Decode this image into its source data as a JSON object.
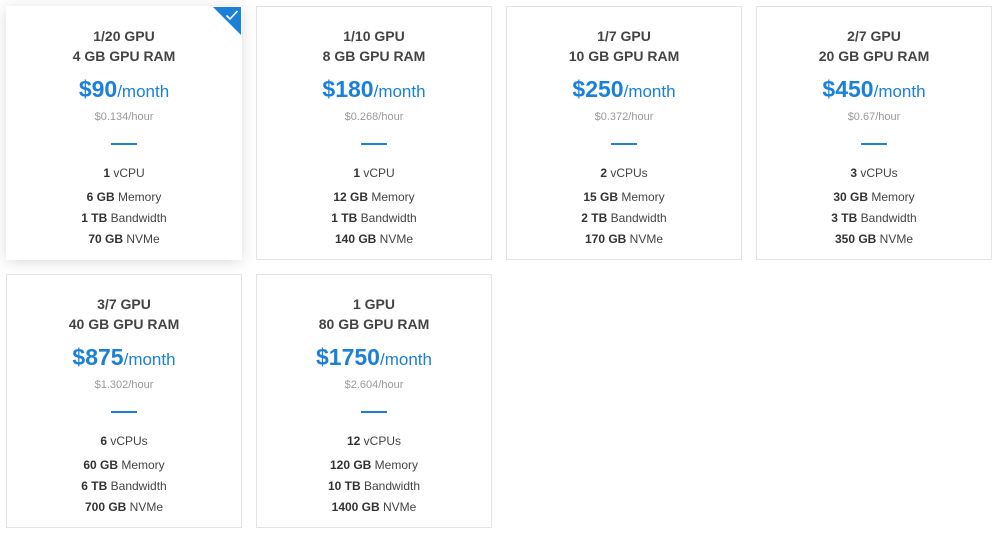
{
  "accent_color": "#1a80d8",
  "plans": [
    {
      "gpu": "1/20 GPU",
      "ram": "4 GB GPU RAM",
      "price": "$90",
      "price_unit": "/month",
      "hourly": "$0.134/hour",
      "specs": [
        {
          "value": "1",
          "label": "vCPU"
        },
        {
          "value": "6 GB",
          "label": "Memory"
        },
        {
          "value": "1 TB",
          "label": "Bandwidth"
        },
        {
          "value": "70 GB",
          "label": "NVMe"
        }
      ],
      "selected": true
    },
    {
      "gpu": "1/10 GPU",
      "ram": "8 GB GPU RAM",
      "price": "$180",
      "price_unit": "/month",
      "hourly": "$0.268/hour",
      "specs": [
        {
          "value": "1",
          "label": "vCPU"
        },
        {
          "value": "12 GB",
          "label": "Memory"
        },
        {
          "value": "1 TB",
          "label": "Bandwidth"
        },
        {
          "value": "140 GB",
          "label": "NVMe"
        }
      ],
      "selected": false
    },
    {
      "gpu": "1/7 GPU",
      "ram": "10 GB GPU RAM",
      "price": "$250",
      "price_unit": "/month",
      "hourly": "$0.372/hour",
      "specs": [
        {
          "value": "2",
          "label": "vCPUs"
        },
        {
          "value": "15 GB",
          "label": "Memory"
        },
        {
          "value": "2 TB",
          "label": "Bandwidth"
        },
        {
          "value": "170 GB",
          "label": "NVMe"
        }
      ],
      "selected": false
    },
    {
      "gpu": "2/7 GPU",
      "ram": "20 GB GPU RAM",
      "price": "$450",
      "price_unit": "/month",
      "hourly": "$0.67/hour",
      "specs": [
        {
          "value": "3",
          "label": "vCPUs"
        },
        {
          "value": "30 GB",
          "label": "Memory"
        },
        {
          "value": "3 TB",
          "label": "Bandwidth"
        },
        {
          "value": "350 GB",
          "label": "NVMe"
        }
      ],
      "selected": false
    },
    {
      "gpu": "3/7 GPU",
      "ram": "40 GB GPU RAM",
      "price": "$875",
      "price_unit": "/month",
      "hourly": "$1.302/hour",
      "specs": [
        {
          "value": "6",
          "label": "vCPUs"
        },
        {
          "value": "60 GB",
          "label": "Memory"
        },
        {
          "value": "6 TB",
          "label": "Bandwidth"
        },
        {
          "value": "700 GB",
          "label": "NVMe"
        }
      ],
      "selected": false
    },
    {
      "gpu": "1 GPU",
      "ram": "80 GB GPU RAM",
      "price": "$1750",
      "price_unit": "/month",
      "hourly": "$2.604/hour",
      "specs": [
        {
          "value": "12",
          "label": "vCPUs"
        },
        {
          "value": "120 GB",
          "label": "Memory"
        },
        {
          "value": "10 TB",
          "label": "Bandwidth"
        },
        {
          "value": "1400 GB",
          "label": "NVMe"
        }
      ],
      "selected": false
    }
  ]
}
